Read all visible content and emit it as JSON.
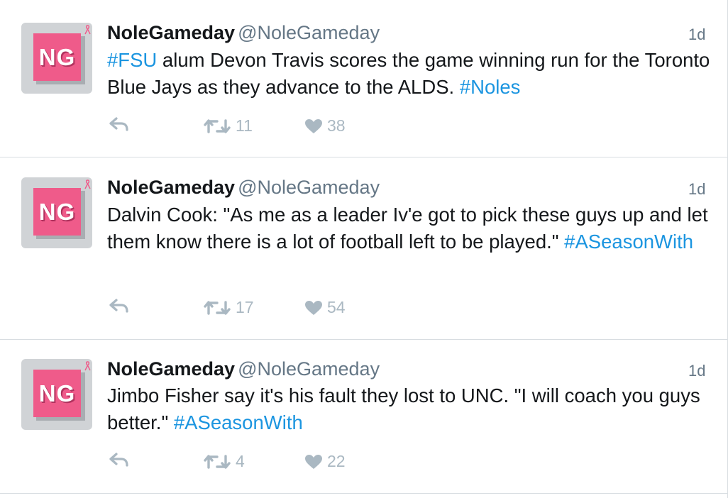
{
  "tweets": [
    {
      "avatar_text": "NG",
      "name": "NoleGameday",
      "handle": "@NoleGameday",
      "time": "1d",
      "text": [
        {
          "t": "#FSU",
          "tag": true
        },
        {
          "t": " alum Devon Travis scores the game winning run for the Toronto Blue Jays as they advance to the ALDS. ",
          "tag": false
        },
        {
          "t": "#Noles",
          "tag": true
        }
      ],
      "retweets": "11",
      "likes": "38"
    },
    {
      "avatar_text": "NG",
      "name": "NoleGameday",
      "handle": "@NoleGameday",
      "time": "1d",
      "text": [
        {
          "t": "Dalvin Cook: \"As me as a leader Iv'e got to pick these guys up and let them know there is a lot of football left to be played.\" ",
          "tag": false
        },
        {
          "t": "#ASeasonWith",
          "tag": true
        }
      ],
      "retweets": "17",
      "likes": "54"
    },
    {
      "avatar_text": "NG",
      "name": "NoleGameday",
      "handle": "@NoleGameday",
      "time": "1d",
      "text": [
        {
          "t": "Jimbo Fisher say it's his fault they lost to UNC. \"I will coach you guys better.\" ",
          "tag": false
        },
        {
          "t": "#ASeasonWith",
          "tag": true
        }
      ],
      "retweets": "4",
      "likes": "22"
    }
  ],
  "colors": {
    "hashtag": "#1b95e0",
    "muted": "#657786",
    "action": "#aab8c2",
    "avatar_pink": "#ef5b8a"
  },
  "icons": {
    "reply": "reply-icon",
    "retweet": "retweet-icon",
    "like": "heart-icon",
    "ribbon": "pink-ribbon-icon"
  }
}
